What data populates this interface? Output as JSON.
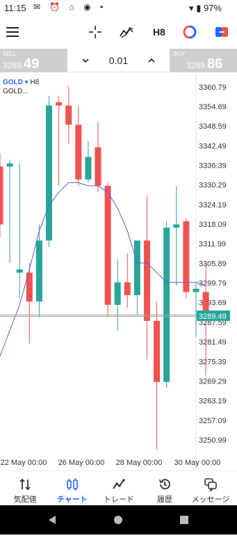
{
  "status": {
    "time": "11:15",
    "icons": "✉ ⏰ ⌂ ◉ •",
    "battery": "97%"
  },
  "toolbar": {
    "timeframe": "H8"
  },
  "trade": {
    "sell_label": "SELL",
    "sell_price_small": "3289.",
    "sell_price_big": "49",
    "buy_label": "BUY",
    "buy_price_small": "3289.",
    "buy_price_big": "86",
    "lot": "0.01"
  },
  "symbol": {
    "name": "GOLD",
    "arrow": "▾",
    "timeframe": "H8",
    "description": "GOLD..."
  },
  "colors": {
    "bull": "#26a69a",
    "bear": "#ef5350",
    "ma": "#5c5ce0",
    "accent": "#2962ff"
  },
  "chart_data": {
    "type": "candlestick",
    "symbol": "GOLD",
    "timeframe": "H8",
    "ylim": [
      3246,
      3364
    ],
    "y_ticks": [
      3360.79,
      3354.69,
      3348.59,
      3342.49,
      3336.39,
      3330.29,
      3324.19,
      3318.09,
      3311.99,
      3305.89,
      3299.79,
      3293.69,
      3287.59,
      3281.49,
      3275.39,
      3269.29,
      3263.19,
      3257.09,
      3250.99
    ],
    "x_ticks": [
      "22 May 00:00",
      "26 May 00:00",
      "28 May 00:00",
      "30 May 00:00"
    ],
    "current_price": "3289.49",
    "candles": [
      {
        "o": 3336.0,
        "h": 3340.0,
        "l": 3314.0,
        "c": 3318.0
      },
      {
        "o": 3336.0,
        "h": 3338.0,
        "l": 3306.0,
        "c": 3337.0
      },
      {
        "o": 3303.0,
        "h": 3337.0,
        "l": 3295.0,
        "c": 3304.0
      },
      {
        "o": 3303.0,
        "h": 3306.0,
        "l": 3281.0,
        "c": 3294.0
      },
      {
        "o": 3294.0,
        "h": 3318.0,
        "l": 3289.0,
        "c": 3313.0
      },
      {
        "o": 3313.0,
        "h": 3358.0,
        "l": 3311.0,
        "c": 3355.0
      },
      {
        "o": 3356.0,
        "h": 3358.0,
        "l": 3330.0,
        "c": 3355.0
      },
      {
        "o": 3355.0,
        "h": 3361.0,
        "l": 3343.0,
        "c": 3349.0
      },
      {
        "o": 3349.0,
        "h": 3355.0,
        "l": 3330.0,
        "c": 3332.0
      },
      {
        "o": 3332.0,
        "h": 3344.0,
        "l": 3331.0,
        "c": 3339.0
      },
      {
        "o": 3342.0,
        "h": 3350.0,
        "l": 3328.0,
        "c": 3330.0
      },
      {
        "o": 3330.0,
        "h": 3331.0,
        "l": 3289.0,
        "c": 3293.0
      },
      {
        "o": 3293.0,
        "h": 3307.0,
        "l": 3285.0,
        "c": 3300.0
      },
      {
        "o": 3300.0,
        "h": 3309.0,
        "l": 3292.0,
        "c": 3296.0
      },
      {
        "o": 3296.0,
        "h": 3313.0,
        "l": 3290.0,
        "c": 3313.0
      },
      {
        "o": 3313.0,
        "h": 3327.0,
        "l": 3276.0,
        "c": 3288.0
      },
      {
        "o": 3288.0,
        "h": 3294.0,
        "l": 3248.0,
        "c": 3269.0
      },
      {
        "o": 3269.0,
        "h": 3319.0,
        "l": 3267.0,
        "c": 3317.0
      },
      {
        "o": 3317.0,
        "h": 3330.0,
        "l": 3299.0,
        "c": 3318.0
      },
      {
        "o": 3319.0,
        "h": 3320.0,
        "l": 3295.0,
        "c": 3297.0
      },
      {
        "o": 3297.0,
        "h": 3300.0,
        "l": 3283.0,
        "c": 3298.0
      },
      {
        "o": 3297.0,
        "h": 3306.0,
        "l": 3271.0,
        "c": 3289.49
      }
    ],
    "ma_series": [
      3277,
      3285,
      3293,
      3304,
      3316,
      3324,
      3328,
      3331,
      3331,
      3330,
      3330,
      3328,
      3323,
      3316,
      3306,
      3306,
      3303,
      3300,
      3300,
      3300,
      3300,
      3299
    ]
  },
  "nav": {
    "items": [
      {
        "label": "気配値"
      },
      {
        "label": "チャート"
      },
      {
        "label": "トレード"
      },
      {
        "label": "履歴"
      },
      {
        "label": "メッセージ"
      }
    ]
  }
}
